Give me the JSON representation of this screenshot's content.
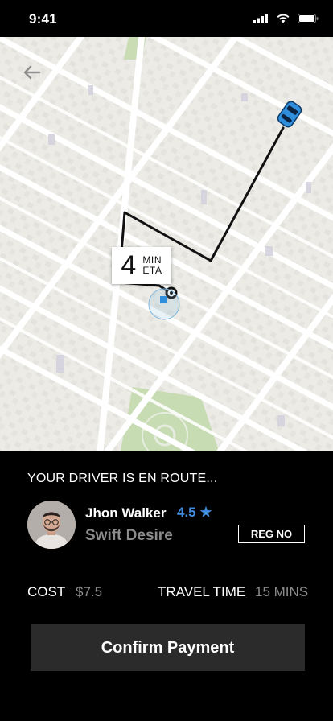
{
  "status_bar": {
    "time": "9:41",
    "icons": [
      "signal-icon",
      "wifi-icon",
      "battery-icon"
    ]
  },
  "map": {
    "back_icon": "arrow-left-icon",
    "eta": {
      "value": "4",
      "unit_line1": "MIN",
      "unit_line2": "ETA"
    },
    "vehicle_icon": "car-icon",
    "route_color": "#111111",
    "vehicle_color": "#2f8fdc"
  },
  "driver_panel": {
    "status_text": "YOUR DRIVER IS EN ROUTE...",
    "driver_name": "Jhon Walker",
    "rating": "4.5 ★",
    "car_model": "Swift Desire",
    "reg_label": "REG NO",
    "cost_label": "COST",
    "cost_value": "$7.5",
    "travel_label": "TRAVEL TIME",
    "travel_value": "15 MINS",
    "confirm_label": "Confirm Payment",
    "accent_color": "#3f8cdf"
  }
}
